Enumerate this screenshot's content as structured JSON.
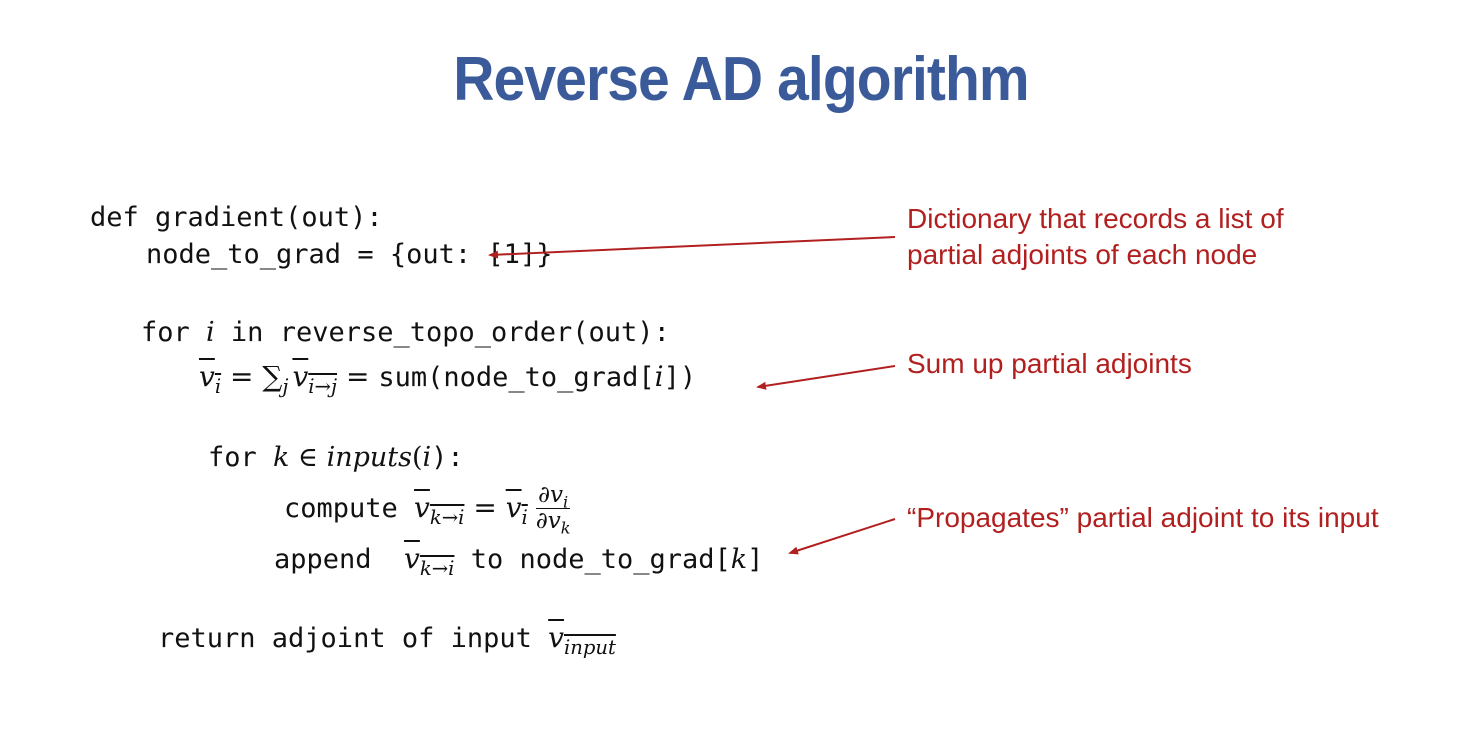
{
  "title": "Reverse AD algorithm",
  "code": {
    "line1": "def gradient(out):",
    "line2": "node_to_grad = {out: [1]}",
    "line3_pre": "for ",
    "line3_var": "i",
    "line3_post": " in reverse_topo_order(out):",
    "line4": {
      "v": "v",
      "sub_i": "i",
      "eq": " = ",
      "sum": "∑",
      "sub_j": "j",
      "sub_itoj": "i→j",
      "eq2": " = ",
      "rest": "sum(node_to_grad[",
      "idx": "i",
      "close": "])"
    },
    "line5": {
      "pre": "for ",
      "k": "k",
      "in": " ∈ ",
      "inputs": "inputs",
      "paren_open": "(",
      "i": "i",
      "paren_close": "):"
    },
    "line6": {
      "pre": "compute ",
      "v": "v",
      "sub_ktoi": "k→i",
      "eq": " = ",
      "vbar": "v",
      "sub_i": "i",
      "frac_num": "∂v",
      "frac_num_sub": "i",
      "frac_den": "∂v",
      "frac_den_sub": "k"
    },
    "line7": {
      "pre": "append  ",
      "v": "v",
      "sub_ktoi": "k→i",
      "mid": " to node_to_grad[",
      "k": "k",
      "close": "]"
    },
    "line8": {
      "pre": "return adjoint of input ",
      "v": "v",
      "sub": "input"
    }
  },
  "annotations": {
    "note1_line1": "Dictionary that records a list of",
    "note1_line2": "partial adjoints of each node",
    "note2": "Sum up partial adjoints",
    "note3": "“Propagates” partial adjoint to its input"
  },
  "colors": {
    "title": "#3b5a9a",
    "annotation": "#b11f1f",
    "code": "#111111"
  }
}
